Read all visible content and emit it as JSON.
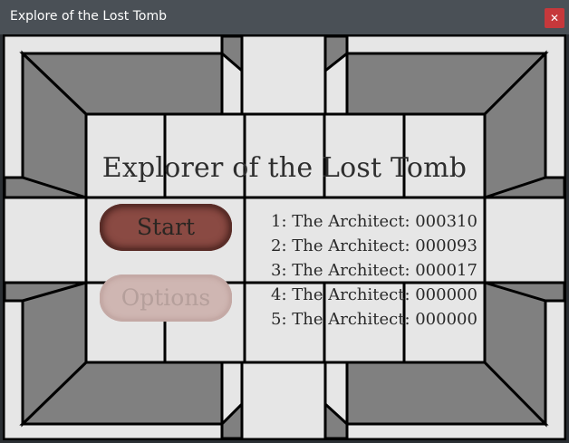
{
  "window": {
    "title": "Explore of the Lost Tomb",
    "close_glyph": "✕"
  },
  "game": {
    "title": "Explorer of the Lost Tomb",
    "start_label": "Start",
    "options_label": "Options",
    "highscores": [
      "1: The Architect: 000310",
      "2: The Architect: 000093",
      "3: The Architect: 000017",
      "4: The Architect: 000000",
      "5: The Architect: 000000"
    ]
  },
  "colors": {
    "title_bar": "#4a5056",
    "close_button": "#c6383b",
    "floor": "#e6e6e6",
    "wall": "#808080",
    "start_button": "#8a4a43",
    "options_button_disabled": "#cfb6b2"
  }
}
